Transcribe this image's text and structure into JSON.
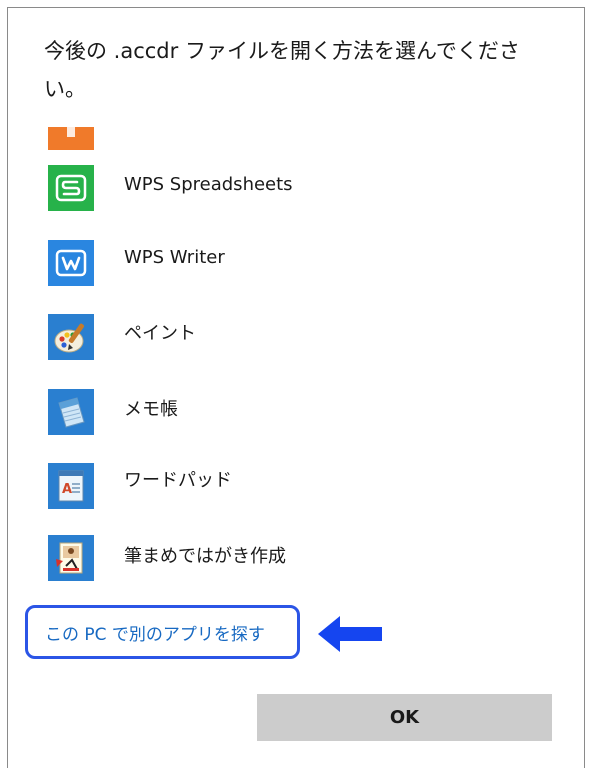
{
  "dialog": {
    "title": "今後の .accdr ファイルを開く方法を選んでください。"
  },
  "apps": [
    {
      "name": "WPS Spreadsheets",
      "icon": "wps-spreadsheets-icon",
      "color": "#27b24a"
    },
    {
      "name": "WPS Writer",
      "icon": "wps-writer-icon",
      "color": "#2a86e0"
    },
    {
      "name": "ペイント",
      "icon": "paint-icon",
      "color": "#2a7fd0"
    },
    {
      "name": "メモ帳",
      "icon": "notepad-icon",
      "color": "#2a7fd0"
    },
    {
      "name": "ワードパッド",
      "icon": "wordpad-icon",
      "color": "#2a7fd0"
    },
    {
      "name": "筆まめではがき作成",
      "icon": "fudemame-icon",
      "color": "#2a7fd0"
    }
  ],
  "more_apps_link": "この PC で別のアプリを探す",
  "highlight_color": "#2b55e6",
  "ok_label": "OK"
}
